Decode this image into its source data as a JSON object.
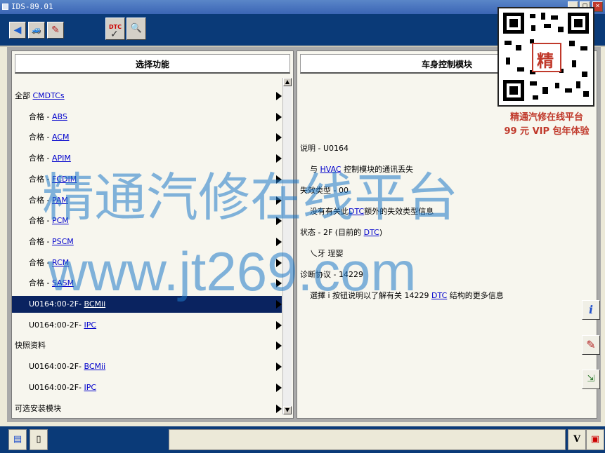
{
  "window": {
    "title": "IDS-89.01"
  },
  "toolbar": {
    "icons": [
      "back-arrow-icon",
      "vehicle-icon",
      "toolbox-icon",
      "dtc-check-icon",
      "dtc-search-icon"
    ],
    "dtc_label": "DTC"
  },
  "left_panel": {
    "title": "选择功能",
    "rows": [
      {
        "prefix": "全部 ",
        "link": "CMDTCs",
        "indent": false
      },
      {
        "prefix": "合格 - ",
        "link": "ABS",
        "indent": true
      },
      {
        "prefix": "合格 - ",
        "link": "ACM",
        "indent": true
      },
      {
        "prefix": "合格 - ",
        "link": "APIM",
        "indent": true
      },
      {
        "prefix": "合格 - ",
        "link": "FCDIM",
        "indent": true
      },
      {
        "prefix": "合格 - ",
        "link": "PAM",
        "indent": true
      },
      {
        "prefix": "合格 - ",
        "link": "PCM",
        "indent": true
      },
      {
        "prefix": "合格 - ",
        "link": "PSCM",
        "indent": true
      },
      {
        "prefix": "合格 - ",
        "link": "RCM",
        "indent": true
      },
      {
        "prefix": "合格 - ",
        "link": "SASM",
        "indent": true
      },
      {
        "prefix": "U0164:00-2F- ",
        "link": "BCMii",
        "indent": true,
        "selected": true
      },
      {
        "prefix": "U0164:00-2F- ",
        "link": "IPC",
        "indent": true
      },
      {
        "prefix": "快照资料",
        "link": "",
        "indent": false
      },
      {
        "prefix": "U0164:00-2F- ",
        "link": "BCMii",
        "indent": true
      },
      {
        "prefix": "U0164:00-2F- ",
        "link": "IPC",
        "indent": true
      },
      {
        "prefix": "可选安装模块",
        "link": "",
        "indent": false
      }
    ]
  },
  "right_panel": {
    "title": "车身控制模块",
    "lines": [
      {
        "pre": "说明 - U0164",
        "link": "",
        "post": "",
        "indent": false
      },
      {
        "pre": "与 ",
        "link": "HVAC",
        "post": " 控制模块的通讯丢失",
        "indent": true
      },
      {
        "pre": "失效类型 - 00",
        "link": "",
        "post": "",
        "indent": false
      },
      {
        "pre": "没有有关此",
        "link": "DTC",
        "post": "额外的失效类型信息",
        "indent": true
      },
      {
        "pre": "状态 - 2F (目前的 ",
        "link": "DTC",
        "post": ")",
        "indent": false
      },
      {
        "pre": "乀牙     珵婴",
        "link": "",
        "post": "",
        "indent": true
      },
      {
        "pre": "诊断协议 - 14229",
        "link": "",
        "post": "",
        "indent": false
      },
      {
        "pre": "選擇 i 按钮说明以了解有关 14229 ",
        "link": "DTC",
        "post": " 结构的更多信息",
        "indent": true
      }
    ]
  },
  "side_buttons": [
    "info-icon",
    "checklist-pencil-icon",
    "document-arrow-icon"
  ],
  "status_bar": {
    "text": "",
    "right_icons": [
      "vehicle-v-icon",
      "record-icon"
    ]
  },
  "watermark": {
    "line1": "精通汽修在线平台",
    "line2": "www.jt269.com"
  },
  "promo": {
    "line1": "精通汽修在线平台",
    "line2": "99 元 VIP 包年体验",
    "qr_center": "精"
  }
}
